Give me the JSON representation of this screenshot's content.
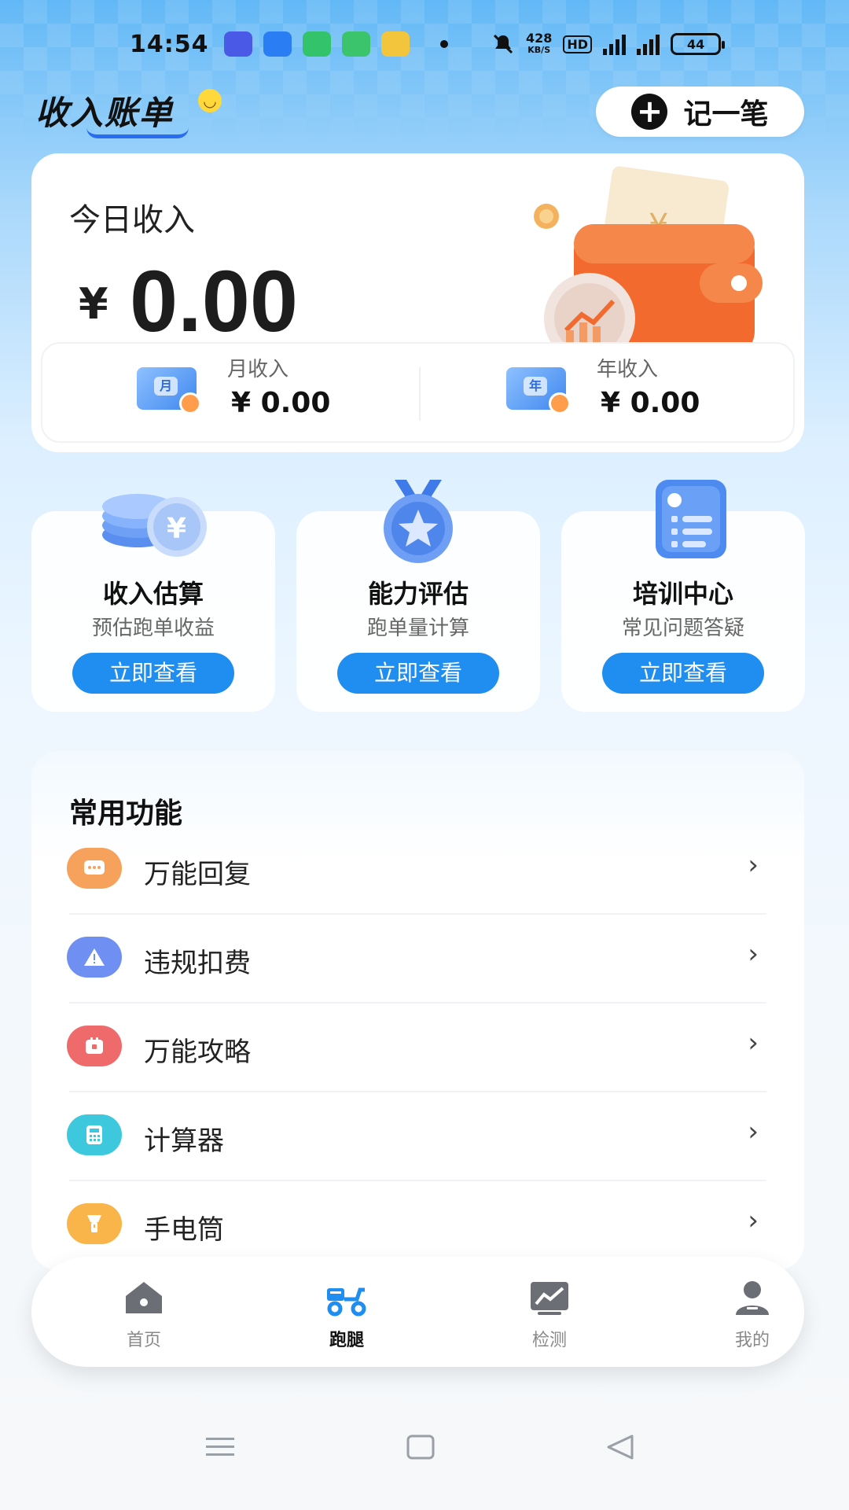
{
  "status_bar": {
    "time": "14:54",
    "net_speed": "428",
    "net_unit": "KB/S",
    "hd": "HD",
    "battery": "44"
  },
  "header": {
    "logo_text": "收入账单",
    "add_button_label": "记一笔"
  },
  "income": {
    "today_label": "今日收入",
    "currency": "¥",
    "today_amount": "0.00",
    "month_label": "月收入",
    "month_icon_text": "月",
    "month_value": "¥ 0.00",
    "year_label": "年收入",
    "year_icon_text": "年",
    "year_value": "¥ 0.00"
  },
  "features": [
    {
      "title": "收入估算",
      "subtitle": "预估跑单收益",
      "button": "立即查看",
      "icon": "coins-icon"
    },
    {
      "title": "能力评估",
      "subtitle": "跑单量计算",
      "button": "立即查看",
      "icon": "medal-icon"
    },
    {
      "title": "培训中心",
      "subtitle": "常见问题答疑",
      "button": "立即查看",
      "icon": "checklist-icon"
    }
  ],
  "common": {
    "title": "常用功能",
    "items": [
      {
        "label": "万能回复",
        "icon": "message-icon",
        "color": "#f7a25c"
      },
      {
        "label": "违规扣费",
        "icon": "warning-icon",
        "color": "#6f8ff2"
      },
      {
        "label": "万能攻略",
        "icon": "guide-icon",
        "color": "#ef6b6b"
      },
      {
        "label": "计算器",
        "icon": "calculator-icon",
        "color": "#3ec8dd"
      },
      {
        "label": "手电筒",
        "icon": "flashlight-icon",
        "color": "#f9b44a"
      }
    ],
    "arrow": "›"
  },
  "nav": {
    "items": [
      {
        "label": "首页",
        "icon": "home-icon"
      },
      {
        "label": "跑腿",
        "icon": "scooter-icon",
        "active": true
      },
      {
        "label": "检测",
        "icon": "chart-icon"
      },
      {
        "label": "我的",
        "icon": "user-icon"
      }
    ]
  },
  "colors": {
    "accent": "#1f8ef0",
    "wallet": "#f26a2e"
  }
}
